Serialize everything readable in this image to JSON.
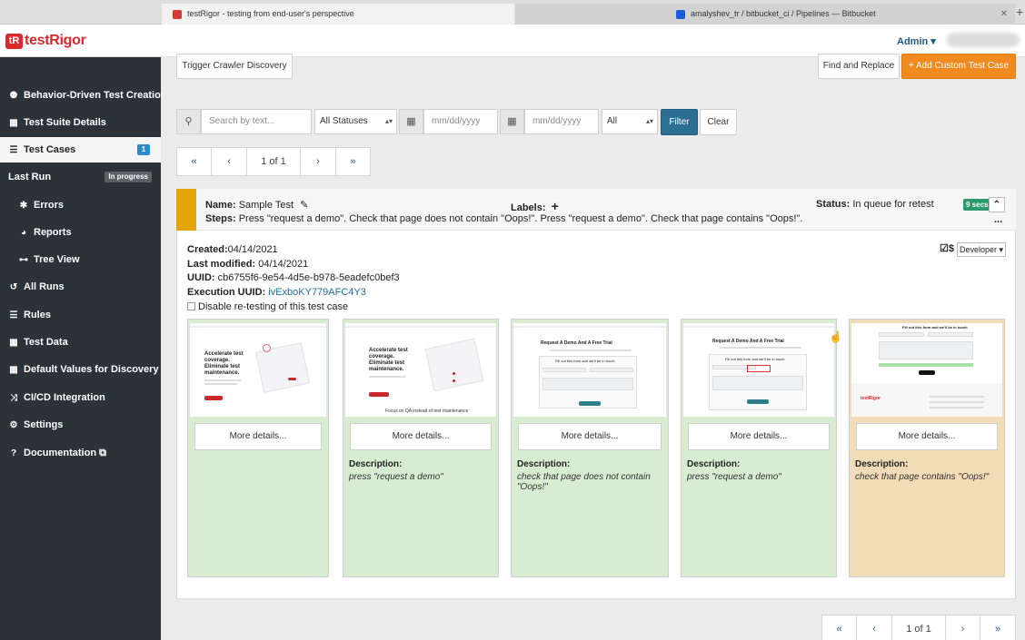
{
  "browser": {
    "tabs": [
      {
        "title": "testRigor - testing from end-user's perspective",
        "active": true
      },
      {
        "title": "amalyshev_tr / bitbucket_ci / Pipelines — Bitbucket",
        "active": false
      }
    ],
    "new_tab": "+"
  },
  "header": {
    "logo_badge": "tR",
    "logo_text": "testRigor",
    "admin_label": "Admin ▾"
  },
  "sidebar": {
    "items": [
      {
        "label": "Behavior-Driven Test Creation",
        "icon": "people-icon",
        "glyph": "⚉"
      },
      {
        "label": "Test Suite Details",
        "icon": "grid-icon",
        "glyph": "▦"
      },
      {
        "label": "Test Cases",
        "icon": "list-icon",
        "glyph": "☰",
        "count": "1",
        "active": true
      },
      {
        "label": "Last Run",
        "badge": "In progress"
      },
      {
        "label": "Errors",
        "icon": "bug-icon",
        "glyph": "✱",
        "sub": true
      },
      {
        "label": "Reports",
        "icon": "pie-chart-icon",
        "glyph": "◕",
        "sub": true
      },
      {
        "label": "Tree View",
        "icon": "sitemap-icon",
        "glyph": "⊶",
        "sub": true
      },
      {
        "label": "All Runs",
        "icon": "history-icon",
        "glyph": "↺"
      },
      {
        "label": "Rules",
        "icon": "list-icon",
        "glyph": "☰"
      },
      {
        "label": "Test Data",
        "icon": "table-icon",
        "glyph": "▦"
      },
      {
        "label": "Default Values for Discovery",
        "icon": "table-icon",
        "glyph": "▦"
      },
      {
        "label": "CI/CD Integration",
        "icon": "shuffle-icon",
        "glyph": "⤨"
      },
      {
        "label": "Settings",
        "icon": "gears-icon",
        "glyph": "⚙"
      },
      {
        "label": "Documentation ⧉",
        "icon": "question-icon",
        "glyph": "?"
      }
    ]
  },
  "toolbar": {
    "crawler_button": "Trigger Crawler Discovery",
    "find_replace_button": "Find and Replace",
    "add_custom_button": "+ Add Custom Test Case"
  },
  "filters": {
    "search_placeholder": "Search by text...",
    "status_select": "All Statuses",
    "date_from_placeholder": "mm/dd/yyyy",
    "date_to_placeholder": "mm/dd/yyyy",
    "all_select": "All",
    "filter_button": "Filter",
    "clear_button": "Clear"
  },
  "pagination": {
    "first": "«",
    "prev": "‹",
    "page": "1 of 1",
    "next": "›",
    "last": "»"
  },
  "test_case": {
    "name_label": "Name:",
    "name": "Sample Test",
    "labels_label": "Labels:",
    "add_label": "+",
    "status_label": "Status:",
    "status": "In queue for retest",
    "duration": "9 secs",
    "steps_label": "Steps:",
    "steps": "Press \"request a demo\". Check that page does not contain \"Oops!\". Press \"request a demo\". Check that page contains \"Oops!\".",
    "ellipsis": "...",
    "created_label": "Created:",
    "created": "04/14/2021",
    "modified_label": "Last modified:",
    "modified": "04/14/2021",
    "uuid_label": "UUID:",
    "uuid": "cb6755f6-9e54-4d5e-b978-5eadefc0bef3",
    "exec_uuid_label": "Execution UUID:",
    "exec_uuid": "ivExboKY779AFC4Y3",
    "disable_retest_label": "Disable re-testing of this test case",
    "cost_label": "$",
    "role_select": "Developer ▾"
  },
  "screenshots": [
    {
      "more": "More details...",
      "desc_label": "",
      "desc": "",
      "status_color": "#d8ecd2",
      "thumb": {
        "heading1": "Accelerate test",
        "heading2": "coverage.",
        "heading3": "Eliminate test",
        "heading4": "maintenance.",
        "caption": ""
      }
    },
    {
      "more": "More details...",
      "desc_label": "Description:",
      "desc": "press \"request a demo\"",
      "status_color": "#d8ecd2",
      "thumb": {
        "heading1": "Accelerate test",
        "heading2": "coverage.",
        "heading3": "Eliminate test",
        "heading4": "maintenance.",
        "caption": "Focus on QA instead of test maintenance"
      }
    },
    {
      "more": "More details...",
      "desc_label": "Description:",
      "desc": "check that page does not contain \"Oops!\"",
      "status_color": "#d8ecd2",
      "thumb": {
        "heading1": "Request A Demo And A Free Trial",
        "heading2": "Fill out this form and we'll be in touch",
        "heading3": "",
        "heading4": "",
        "caption": ""
      }
    },
    {
      "more": "More details...",
      "desc_label": "Description:",
      "desc": "press \"request a demo\"",
      "status_color": "#d8ecd2",
      "thumb": {
        "heading1": "Request A Demo And A Free Trial",
        "heading2": "Fill out this form and we'll be in touch",
        "heading3": "",
        "heading4": "",
        "caption": ""
      }
    },
    {
      "more": "More details...",
      "desc_label": "Description:",
      "desc": "check that page contains \"Oops!\"",
      "status_color": "#f2dcb8",
      "thumb": {
        "heading1": "Fill out this form and we'll be in touch",
        "heading2": "testRigor",
        "heading3": "",
        "heading4": "",
        "caption": ""
      }
    }
  ],
  "bottom_pagination": {
    "first": "«",
    "prev": "‹",
    "page": "1 of 1",
    "next": "›",
    "last": "»"
  }
}
